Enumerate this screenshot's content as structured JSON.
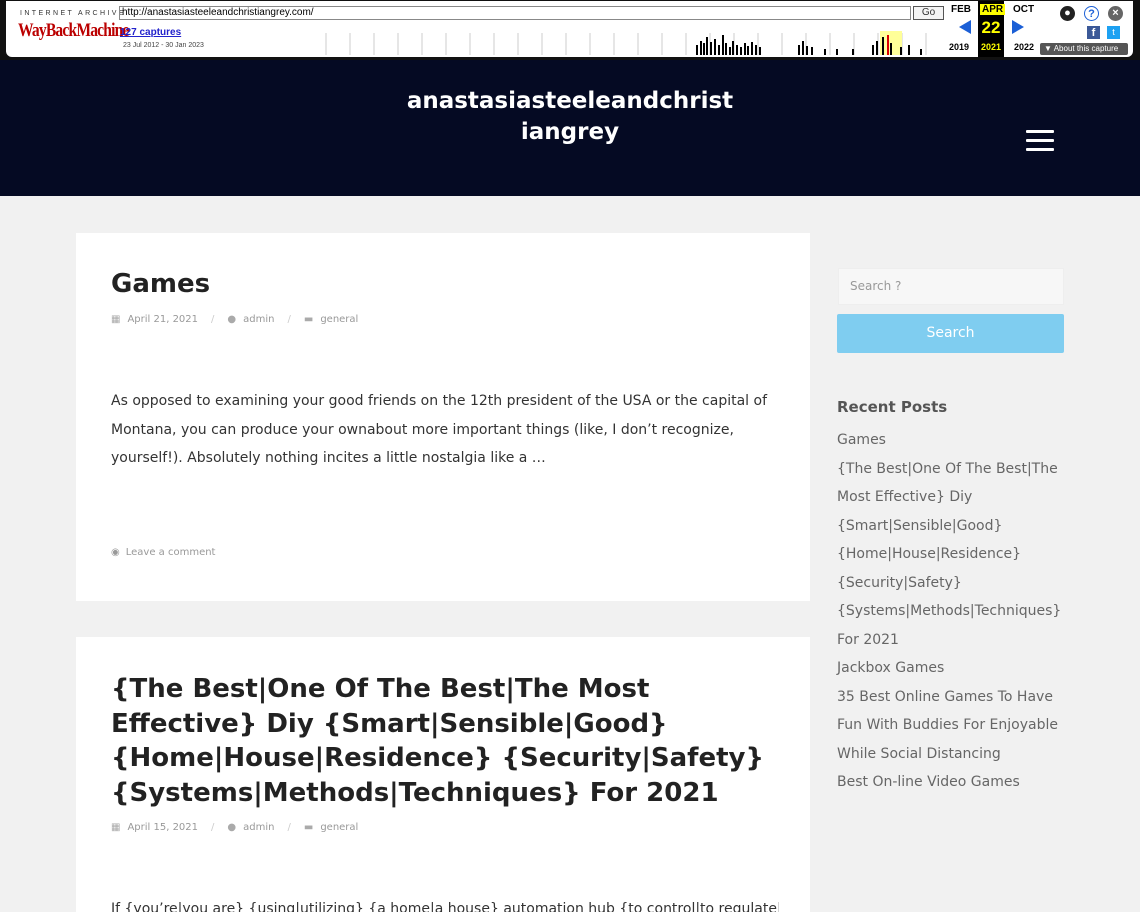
{
  "wayback": {
    "logo_top": "INTERNET ARCHIVE",
    "logo": "WayBackMachine",
    "url": "http://anastasiasteeleandchristiangrey.com/",
    "go_label": "Go",
    "captures": "127 captures",
    "range": "23 Jul 2012 - 30 Jan 2023",
    "months": [
      "FEB",
      "APR",
      "OCT"
    ],
    "day": "22",
    "years": [
      "2019",
      "2021",
      "2022"
    ],
    "about": "About this capture"
  },
  "site": {
    "title": "anastasiasteeleandchristiangrey"
  },
  "posts": [
    {
      "title": "Games",
      "date": "April 21, 2021",
      "author": "admin",
      "category": "general",
      "excerpt": "As opposed to examining your good friends on the 12th president of the USA or the capital of Montana, you can produce your ownabout more important things (like, I don’t recognize, yourself!). Absolutely nothing incites a little nostalgia like a …",
      "comment_link": "Leave a comment"
    },
    {
      "title": "{The Best|One Of The Best|The Most Effective} Diy {Smart|Sensible|Good} {Home|House|Residence} {Security|Safety} {Systems|Methods|Techniques} For 2021",
      "date": "April 15, 2021",
      "author": "admin",
      "category": "general",
      "excerpt": "If {you’re|you are} {using|utilizing} {a home|a house} automation hub {to control|to regulate|to manage}"
    }
  ],
  "sidebar": {
    "search_placeholder": "Search ?",
    "search_button": "Search",
    "recent_title": "Recent Posts",
    "recent_posts": [
      "Games",
      "{The Best|One Of The Best|The Most Effective} Diy {Smart|Sensible|Good} {Home|House|Residence} {Security|Safety} {Systems|Methods|Techniques} For 2021",
      "Jackbox Games",
      "35 Best Online Games To Have Fun With Buddies For Enjoyable While Social Distancing",
      "Best On-line Video Games"
    ]
  }
}
